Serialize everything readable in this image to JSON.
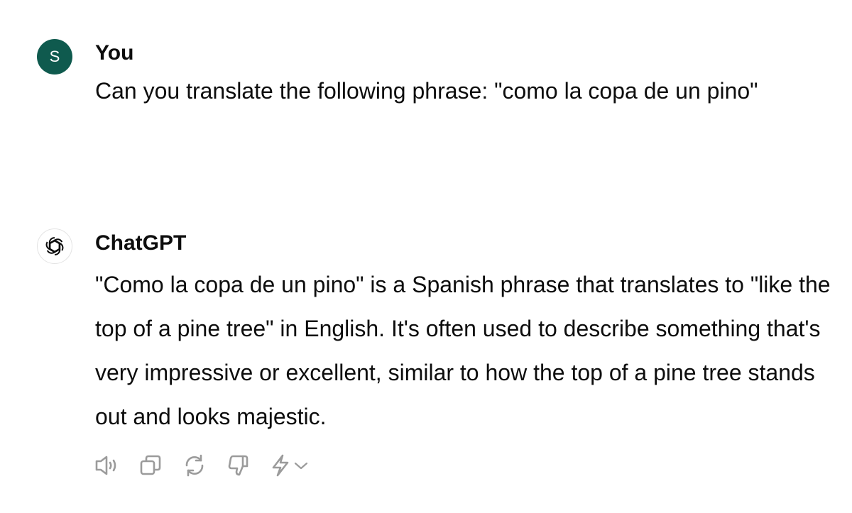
{
  "user_message": {
    "avatar_initial": "S",
    "author": "You",
    "text": "Can you translate the following phrase: \"como la copa de un pino\""
  },
  "assistant_message": {
    "avatar_icon": "openai-logo-icon",
    "author": "ChatGPT",
    "text": "\"Como la copa de un pino\" is a Spanish phrase that translates to \"like the top of a pine tree\" in English. It's often used to describe something that's very impressive or excellent, similar to how the top of a pine tree stands out and looks majestic."
  },
  "actions": [
    "speaker-icon",
    "copy-icon",
    "regenerate-icon",
    "thumbs-down-icon",
    "lightning-icon",
    "chevron-down-icon"
  ],
  "colors": {
    "user_avatar_bg": "#0f5a4e",
    "text": "#0d0d0d",
    "icon": "#9b9b9b"
  }
}
